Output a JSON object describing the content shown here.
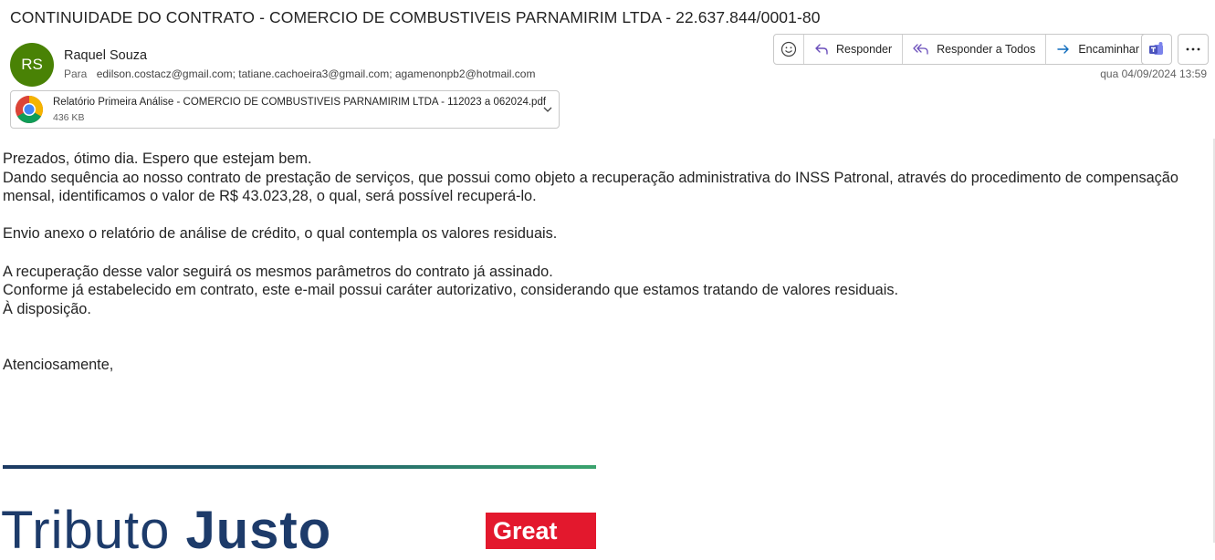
{
  "email": {
    "subject": "CONTINUIDADE DO CONTRATO - COMERCIO DE COMBUSTIVEIS PARNAMIRIM LTDA - 22.637.844/0001-80",
    "sender": {
      "initials": "RS",
      "name": "Raquel Souza",
      "avatar_color": "#498205"
    },
    "to_label": "Para",
    "recipients": "edilson.costacz@gmail.com; tatiane.cachoeira3@gmail.com; agamenonpb2@hotmail.com",
    "date": "qua 04/09/2024 13:59"
  },
  "toolbar": {
    "reply_label": "Responder",
    "reply_all_label": "Responder a Todos",
    "forward_label": "Encaminhar"
  },
  "attachment": {
    "name": "Relatório Primeira Análise - COMERCIO DE COMBUSTIVEIS PARNAMIRIM LTDA - 112023 a 062024.pdf",
    "size": "436 KB"
  },
  "body": {
    "p1": "Prezados, ótimo dia. Espero que estejam bem.",
    "p2": "Dando sequência ao nosso contrato de prestação de serviços, que possui como objeto a recuperação administrativa do INSS Patronal, através do procedimento de compensação mensal, identificamos o valor de R$ 43.023,28, o qual, será possível recuperá-lo.",
    "p3": "Envio anexo o relatório de análise de crédito, o qual contempla os valores residuais.",
    "p4": "A recuperação desse valor seguirá os mesmos parâmetros do contrato já assinado.",
    "p5": "Conforme já estabelecido em contrato, este e-mail possui caráter autorizativo, considerando que estamos tratando de valores residuais.",
    "p6": "À disposição.",
    "closing": "Atenciosamente,"
  },
  "signature": {
    "logo_text_light": "Tributo ",
    "logo_text_bold": "Justo",
    "badge_text": "Great"
  },
  "colors": {
    "accent": "#0f6cbd",
    "badge": "#e3182d",
    "logo": "#1d3b6a"
  }
}
